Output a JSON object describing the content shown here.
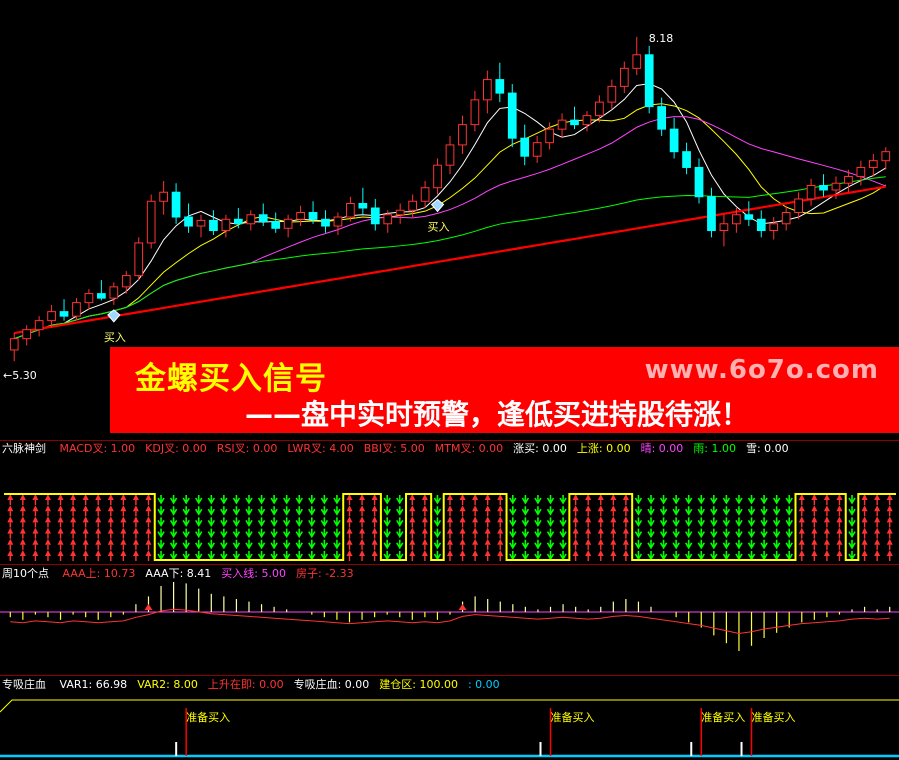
{
  "chart_data": [
    {
      "type": "candlestick",
      "price_labels": {
        "high": "8.18",
        "low": "←5.30"
      },
      "buy_label": "买入",
      "ylim": [
        5.0,
        8.4
      ],
      "candles": [
        {
          "o": 5.4,
          "h": 5.55,
          "l": 5.3,
          "c": 5.5
        },
        {
          "o": 5.5,
          "h": 5.62,
          "l": 5.44,
          "c": 5.58
        },
        {
          "o": 5.58,
          "h": 5.7,
          "l": 5.52,
          "c": 5.66
        },
        {
          "o": 5.66,
          "h": 5.8,
          "l": 5.6,
          "c": 5.74
        },
        {
          "o": 5.74,
          "h": 5.85,
          "l": 5.66,
          "c": 5.7
        },
        {
          "o": 5.7,
          "h": 5.86,
          "l": 5.66,
          "c": 5.82
        },
        {
          "o": 5.82,
          "h": 5.94,
          "l": 5.76,
          "c": 5.9
        },
        {
          "o": 5.9,
          "h": 6.02,
          "l": 5.84,
          "c": 5.86
        },
        {
          "o": 5.86,
          "h": 6.0,
          "l": 5.8,
          "c": 5.96
        },
        {
          "o": 5.96,
          "h": 6.1,
          "l": 5.9,
          "c": 6.06
        },
        {
          "o": 6.06,
          "h": 6.4,
          "l": 6.02,
          "c": 6.35
        },
        {
          "o": 6.35,
          "h": 6.78,
          "l": 6.3,
          "c": 6.72
        },
        {
          "o": 6.72,
          "h": 6.9,
          "l": 6.6,
          "c": 6.8
        },
        {
          "o": 6.8,
          "h": 6.88,
          "l": 6.52,
          "c": 6.58
        },
        {
          "o": 6.58,
          "h": 6.7,
          "l": 6.44,
          "c": 6.5
        },
        {
          "o": 6.5,
          "h": 6.6,
          "l": 6.4,
          "c": 6.55
        },
        {
          "o": 6.55,
          "h": 6.64,
          "l": 6.42,
          "c": 6.46
        },
        {
          "o": 6.46,
          "h": 6.6,
          "l": 6.4,
          "c": 6.56
        },
        {
          "o": 6.56,
          "h": 6.66,
          "l": 6.48,
          "c": 6.52
        },
        {
          "o": 6.52,
          "h": 6.64,
          "l": 6.46,
          "c": 6.6
        },
        {
          "o": 6.6,
          "h": 6.7,
          "l": 6.5,
          "c": 6.54
        },
        {
          "o": 6.54,
          "h": 6.62,
          "l": 6.44,
          "c": 6.48
        },
        {
          "o": 6.48,
          "h": 6.6,
          "l": 6.4,
          "c": 6.56
        },
        {
          "o": 6.56,
          "h": 6.68,
          "l": 6.5,
          "c": 6.62
        },
        {
          "o": 6.62,
          "h": 6.72,
          "l": 6.52,
          "c": 6.56
        },
        {
          "o": 6.56,
          "h": 6.64,
          "l": 6.44,
          "c": 6.5
        },
        {
          "o": 6.5,
          "h": 6.62,
          "l": 6.42,
          "c": 6.58
        },
        {
          "o": 6.58,
          "h": 6.76,
          "l": 6.54,
          "c": 6.7
        },
        {
          "o": 6.7,
          "h": 6.84,
          "l": 6.6,
          "c": 6.66
        },
        {
          "o": 6.66,
          "h": 6.74,
          "l": 6.46,
          "c": 6.52
        },
        {
          "o": 6.52,
          "h": 6.64,
          "l": 6.44,
          "c": 6.6
        },
        {
          "o": 6.6,
          "h": 6.7,
          "l": 6.52,
          "c": 6.64
        },
        {
          "o": 6.64,
          "h": 6.78,
          "l": 6.58,
          "c": 6.72
        },
        {
          "o": 6.72,
          "h": 6.9,
          "l": 6.66,
          "c": 6.84
        },
        {
          "o": 6.84,
          "h": 7.1,
          "l": 6.78,
          "c": 7.04
        },
        {
          "o": 7.04,
          "h": 7.3,
          "l": 6.96,
          "c": 7.22
        },
        {
          "o": 7.22,
          "h": 7.48,
          "l": 7.14,
          "c": 7.4
        },
        {
          "o": 7.4,
          "h": 7.7,
          "l": 7.34,
          "c": 7.62
        },
        {
          "o": 7.62,
          "h": 7.88,
          "l": 7.5,
          "c": 7.8
        },
        {
          "o": 7.8,
          "h": 7.95,
          "l": 7.6,
          "c": 7.68
        },
        {
          "o": 7.68,
          "h": 7.76,
          "l": 7.2,
          "c": 7.28
        },
        {
          "o": 7.28,
          "h": 7.4,
          "l": 7.04,
          "c": 7.12
        },
        {
          "o": 7.12,
          "h": 7.3,
          "l": 7.06,
          "c": 7.24
        },
        {
          "o": 7.24,
          "h": 7.42,
          "l": 7.18,
          "c": 7.36
        },
        {
          "o": 7.36,
          "h": 7.5,
          "l": 7.28,
          "c": 7.44
        },
        {
          "o": 7.44,
          "h": 7.56,
          "l": 7.36,
          "c": 7.4
        },
        {
          "o": 7.4,
          "h": 7.52,
          "l": 7.34,
          "c": 7.48
        },
        {
          "o": 7.48,
          "h": 7.66,
          "l": 7.42,
          "c": 7.6
        },
        {
          "o": 7.6,
          "h": 7.8,
          "l": 7.54,
          "c": 7.74
        },
        {
          "o": 7.74,
          "h": 7.96,
          "l": 7.68,
          "c": 7.9
        },
        {
          "o": 7.9,
          "h": 8.18,
          "l": 7.84,
          "c": 8.02
        },
        {
          "o": 8.02,
          "h": 8.1,
          "l": 7.5,
          "c": 7.56
        },
        {
          "o": 7.56,
          "h": 7.64,
          "l": 7.3,
          "c": 7.36
        },
        {
          "o": 7.36,
          "h": 7.46,
          "l": 7.1,
          "c": 7.16
        },
        {
          "o": 7.16,
          "h": 7.24,
          "l": 6.96,
          "c": 7.02
        },
        {
          "o": 7.02,
          "h": 7.1,
          "l": 6.7,
          "c": 6.76
        },
        {
          "o": 6.76,
          "h": 6.84,
          "l": 6.4,
          "c": 6.46
        },
        {
          "o": 6.46,
          "h": 6.6,
          "l": 6.32,
          "c": 6.52
        },
        {
          "o": 6.52,
          "h": 6.66,
          "l": 6.44,
          "c": 6.6
        },
        {
          "o": 6.6,
          "h": 6.72,
          "l": 6.5,
          "c": 6.56
        },
        {
          "o": 6.56,
          "h": 6.64,
          "l": 6.4,
          "c": 6.46
        },
        {
          "o": 6.46,
          "h": 6.58,
          "l": 6.38,
          "c": 6.52
        },
        {
          "o": 6.52,
          "h": 6.68,
          "l": 6.46,
          "c": 6.62
        },
        {
          "o": 6.62,
          "h": 6.8,
          "l": 6.56,
          "c": 6.74
        },
        {
          "o": 6.74,
          "h": 6.92,
          "l": 6.68,
          "c": 6.86
        },
        {
          "o": 6.86,
          "h": 6.96,
          "l": 6.76,
          "c": 6.82
        },
        {
          "o": 6.82,
          "h": 6.94,
          "l": 6.74,
          "c": 6.88
        },
        {
          "o": 6.88,
          "h": 7.0,
          "l": 6.8,
          "c": 6.94
        },
        {
          "o": 6.94,
          "h": 7.08,
          "l": 6.86,
          "c": 7.02
        },
        {
          "o": 7.02,
          "h": 7.14,
          "l": 6.94,
          "c": 7.08
        },
        {
          "o": 7.08,
          "h": 7.2,
          "l": 7.0,
          "c": 7.16
        }
      ]
    },
    {
      "type": "signal-matrix",
      "title": "六脉神剑",
      "legend": [
        {
          "text": "MACD叉: 1.00",
          "color": "#ff3333"
        },
        {
          "text": "KDJ叉: 0.00",
          "color": "#ff3333"
        },
        {
          "text": "RSI叉: 0.00",
          "color": "#ff3333"
        },
        {
          "text": "LWR叉: 4.00",
          "color": "#ff3333"
        },
        {
          "text": "BBI叉: 5.00",
          "color": "#ff3333"
        },
        {
          "text": "MTM叉: 0.00",
          "color": "#ff3333"
        },
        {
          "text": "涨买: 0.00",
          "color": "#ffffff"
        },
        {
          "text": "上涨: 0.00",
          "color": "#ffff00"
        },
        {
          "text": "晴: 0.00",
          "color": "#ff44ff"
        },
        {
          "text": "雨: 1.00",
          "color": "#00ff00"
        },
        {
          "text": "雪: 0.00",
          "color": "#ffffff"
        }
      ],
      "states": [
        1,
        1,
        1,
        1,
        1,
        1,
        1,
        1,
        1,
        1,
        1,
        1,
        0,
        0,
        0,
        0,
        0,
        0,
        0,
        0,
        0,
        0,
        0,
        0,
        0,
        0,
        0,
        1,
        1,
        1,
        0,
        0,
        1,
        1,
        0,
        1,
        1,
        1,
        1,
        1,
        0,
        0,
        0,
        0,
        0,
        1,
        1,
        1,
        1,
        1,
        0,
        0,
        0,
        0,
        0,
        0,
        0,
        0,
        0,
        0,
        0,
        0,
        0,
        1,
        1,
        1,
        1,
        0,
        1,
        1,
        1
      ]
    },
    {
      "type": "oscillator",
      "title": "周10个点",
      "legend": [
        {
          "text": "AAA上: 10.73",
          "color": "#ff3333"
        },
        {
          "text": "AAA下: 8.41",
          "color": "#ffffff"
        },
        {
          "text": "买入线: 5.00",
          "color": "#ff44ff"
        },
        {
          "text": "房子: -2.33",
          "color": "#ff3333"
        }
      ],
      "values": [
        -2,
        -3,
        -1,
        -2,
        -3,
        -1,
        -2,
        -3,
        -2,
        -1,
        3,
        6,
        10,
        12,
        11,
        9,
        7,
        6,
        5,
        4,
        3,
        2,
        1,
        0,
        -1,
        -2,
        -3,
        -4,
        -3,
        -2,
        -1,
        -2,
        -3,
        -2,
        -3,
        -1,
        4,
        6,
        5,
        4,
        3,
        2,
        1,
        2,
        3,
        2,
        1,
        2,
        4,
        5,
        4,
        2,
        0,
        -2,
        -4,
        -6,
        -9,
        -12,
        -15,
        -13,
        -10,
        -8,
        -6,
        -4,
        -3,
        -2,
        -1,
        1,
        2,
        1,
        2
      ]
    },
    {
      "type": "signal-line",
      "title": "专吸庄血",
      "legend": [
        {
          "text": "VAR1: 66.98",
          "color": "#ffffff"
        },
        {
          "text": "VAR2: 8.00",
          "color": "#ffff00"
        },
        {
          "text": "上升在即: 0.00",
          "color": "#ff3333"
        },
        {
          "text": "专吸庄血: 0.00",
          "color": "#ffffff"
        },
        {
          "text": "建仓区: 100.00",
          "color": "#ffff00"
        },
        {
          "text": ": 0.00",
          "color": "#00ccff"
        }
      ],
      "signal_label": "准备买入",
      "signals": [
        14,
        43,
        55,
        59
      ]
    }
  ],
  "banner": {
    "line1": "金螺买入信号",
    "line2": "——盘中实时预警，逢低买进持股待涨！",
    "watermark": "www.6o7o.com"
  },
  "colors": {
    "up": "#ff3333",
    "down": "#00ffff",
    "ma5": "#ffffff",
    "ma10": "#ffff00",
    "ma20": "#ff44ff",
    "ma60": "#00ff00",
    "ma120": "#ff0000"
  }
}
